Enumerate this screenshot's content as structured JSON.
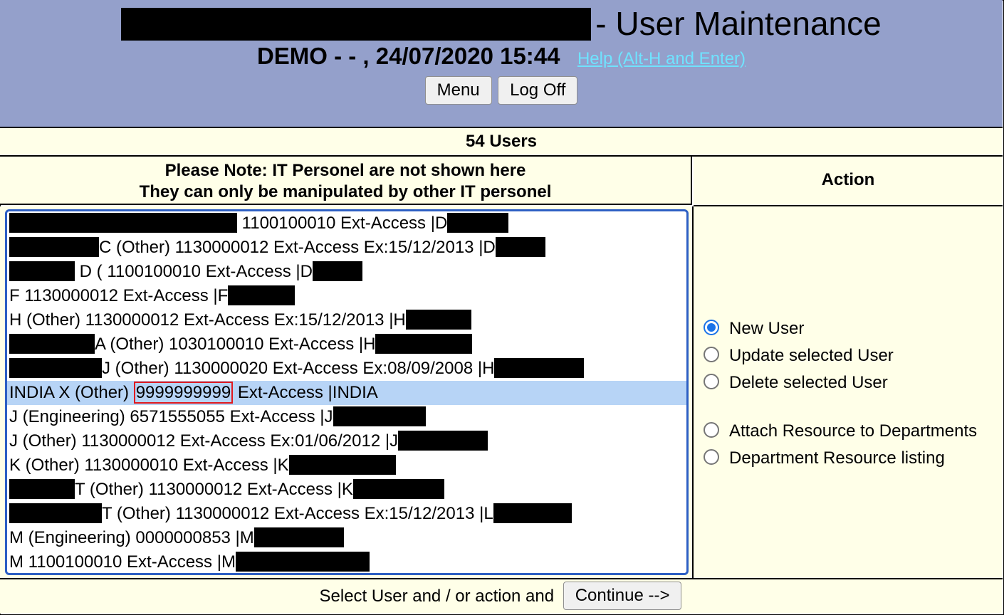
{
  "header": {
    "title_suffix": "- User Maintenance",
    "subtitle": "DEMO - - , 24/07/2020 15:44",
    "help_link": "Help (Alt-H and Enter)",
    "menu_button": "Menu",
    "logoff_button": "Log Off"
  },
  "users_count": "54 Users",
  "note": {
    "line1": "Please Note: IT Personel are not shown here",
    "line2": "They can only be manipulated by other IT personel"
  },
  "action_header": "Action",
  "user_list": {
    "items": [
      {
        "text": " 1100100010 Ext-Access |D"
      },
      {
        "text": "C (Other) 1130000012 Ext-Access Ex:15/12/2013 |D"
      },
      {
        "text": " D ( 1100100010 Ext-Access |D"
      },
      {
        "text": "F 1130000012 Ext-Access |F"
      },
      {
        "text": "H (Other) 1130000012 Ext-Access Ex:15/12/2013 |H"
      },
      {
        "text": "A (Other) 1030100010 Ext-Access |H"
      },
      {
        "text": "J (Other) 1130000020 Ext-Access Ex:08/09/2008 |H"
      },
      {
        "prefix": "INDIA X (Other) ",
        "code": "9999999999",
        "suffix": " Ext-Access |INDIA"
      },
      {
        "text": "J (Engineering) 6571555055 Ext-Access |J"
      },
      {
        "text": "J (Other) 1130000012 Ext-Access Ex:01/06/2012 |J"
      },
      {
        "text": "K (Other) 1130000010 Ext-Access |K"
      },
      {
        "text": "T (Other) 1130000012 Ext-Access |K"
      },
      {
        "text": "T (Other) 1130000012 Ext-Access Ex:15/12/2013 |L"
      },
      {
        "text": "M (Engineering) 0000000853 |M"
      },
      {
        "text": "M 1100100010 Ext-Access |M"
      }
    ]
  },
  "actions": {
    "new_user": "New User",
    "update_user": "Update selected User",
    "delete_user": "Delete selected User",
    "attach_resource": "Attach Resource to Departments",
    "dept_listing": "Department Resource listing",
    "selected": "New User"
  },
  "footer": {
    "prompt": "Select User and / or action and",
    "continue_button": "Continue -->"
  },
  "colors": {
    "header_bg": "#94a0cb",
    "panel_bg": "#ffffe8",
    "selection_bg": "#b7d4f6",
    "highlight_border": "#e0191f",
    "link": "#6fe3ff",
    "accent": "#1a73e8"
  }
}
